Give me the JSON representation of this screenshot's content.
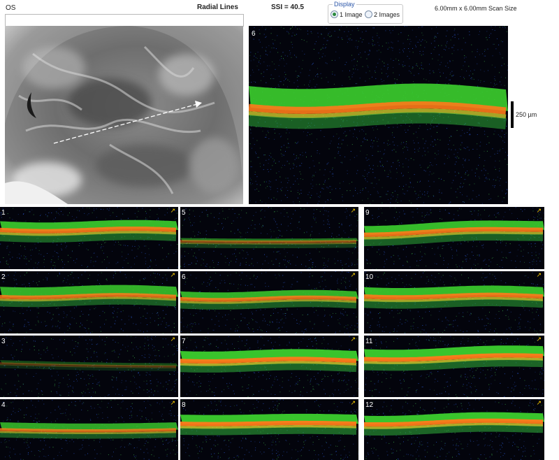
{
  "header": {
    "eye": "OS",
    "mode": "Radial Lines",
    "ssi": "SSI = 40.5",
    "scan_size": "6.00mm x 6.00mm Scan Size"
  },
  "display": {
    "label": "Display",
    "options": [
      "1 Image",
      "2 Images"
    ],
    "selected": "1 Image"
  },
  "main_scan": {
    "label": "6",
    "scale_label": "250 µm"
  },
  "thumbnails": [
    {
      "label": "1"
    },
    {
      "label": "5"
    },
    {
      "label": "9"
    },
    {
      "label": "2"
    },
    {
      "label": "6"
    },
    {
      "label": "10"
    },
    {
      "label": "3"
    },
    {
      "label": "7"
    },
    {
      "label": "11"
    },
    {
      "label": "4"
    },
    {
      "label": "8"
    },
    {
      "label": "12"
    }
  ],
  "colors": {
    "scan_bg": "#03040c",
    "rpe": "#ff7a1a",
    "retina": "#3ccf2e",
    "noise": "#2a55c8"
  }
}
